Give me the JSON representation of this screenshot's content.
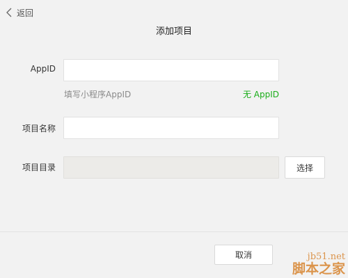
{
  "header": {
    "back_label": "返回",
    "title": "添加项目"
  },
  "form": {
    "appid": {
      "label": "AppID",
      "value": "",
      "hint": "填写小程序AppID",
      "no_appid_link": "无 AppID"
    },
    "project_name": {
      "label": "项目名称",
      "value": ""
    },
    "project_dir": {
      "label": "项目目录",
      "value": "",
      "choose_label": "选择"
    }
  },
  "footer": {
    "cancel_label": "取消"
  },
  "watermark": {
    "line1": "jb51.net",
    "line2": "脚本之家"
  },
  "colors": {
    "background": "#f2f2f2",
    "accent_link": "#1aad19",
    "watermark": "#d98a3a"
  }
}
